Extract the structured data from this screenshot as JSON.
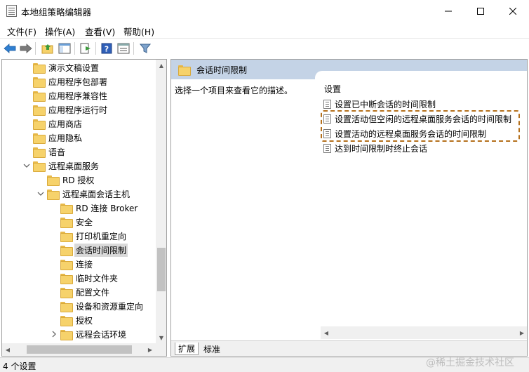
{
  "window": {
    "title": "本地组策略编辑器",
    "minimize_glyph": "─",
    "maximize_glyph": "☐",
    "close_glyph": "✕"
  },
  "menu": {
    "items": [
      "文件(F)",
      "操作(A)",
      "查看(V)",
      "帮助(H)"
    ]
  },
  "toolbar": {
    "icons": [
      "back-arrow-icon",
      "forward-arrow-icon",
      "up-folder-icon",
      "show-hide-tree-icon",
      "export-list-icon",
      "help-icon",
      "properties-icon",
      "filter-icon"
    ]
  },
  "tree": {
    "items": [
      {
        "label": "演示文稿设置",
        "level": 2
      },
      {
        "label": "应用程序包部署",
        "level": 2
      },
      {
        "label": "应用程序兼容性",
        "level": 2
      },
      {
        "label": "应用程序运行时",
        "level": 2
      },
      {
        "label": "应用商店",
        "level": 2
      },
      {
        "label": "应用隐私",
        "level": 2
      },
      {
        "label": "语音",
        "level": 2
      },
      {
        "label": "远程桌面服务",
        "level": 2,
        "expanded": true
      },
      {
        "label": "RD 授权",
        "level": 3
      },
      {
        "label": "远程桌面会话主机",
        "level": 3,
        "expanded": true
      },
      {
        "label": "RD 连接 Broker",
        "level": 4
      },
      {
        "label": "安全",
        "level": 4
      },
      {
        "label": "打印机重定向",
        "level": 4
      },
      {
        "label": "会话时间限制",
        "level": 4,
        "selected": true
      },
      {
        "label": "连接",
        "level": 4
      },
      {
        "label": "临时文件夹",
        "level": 4
      },
      {
        "label": "配置文件",
        "level": 4
      },
      {
        "label": "设备和资源重定向",
        "level": 4
      },
      {
        "label": "授权",
        "level": 4
      },
      {
        "label": "远程会话环境",
        "level": 4,
        "collapsed": true
      }
    ]
  },
  "right": {
    "header_title": "会话时间限制",
    "description": "选择一个项目来查看它的描述。",
    "list_header": "设置",
    "policies": [
      "设置已中断会话的时间限制",
      "设置活动但空闲的远程桌面服务会话的时间限制",
      "设置活动的远程桌面服务会话的时间限制",
      "达到时间限制时终止会话"
    ],
    "highlight_color": "#b5701c"
  },
  "tabs": [
    "扩展",
    "标准"
  ],
  "status": {
    "text": "4 个设置"
  },
  "watermark": "@稀土掘金技术社区"
}
